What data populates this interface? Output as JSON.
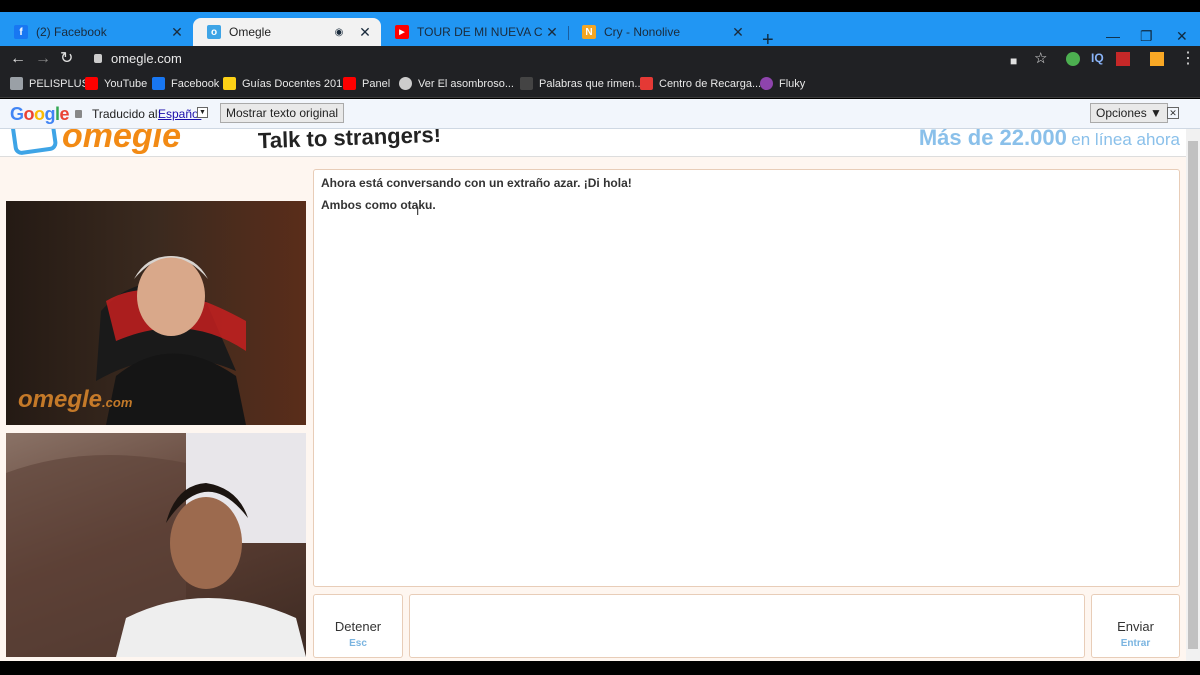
{
  "browser": {
    "tabs": [
      {
        "label": "(2) Facebook",
        "icon": "facebook-icon",
        "color": "#1877f2",
        "glyph": "f"
      },
      {
        "label": "Omegle",
        "icon": "omegle-icon",
        "color": "#3ea4e6",
        "glyph": "o"
      },
      {
        "label": "TOUR DE MI NUEVA CASA (de no",
        "icon": "youtube-icon",
        "color": "#ff0000",
        "glyph": "▶"
      },
      {
        "label": "Cry - Nonolive",
        "icon": "nonolive-icon",
        "color": "#f5a623",
        "glyph": "N"
      }
    ],
    "new_tab": "+",
    "url": "omegle.com",
    "ext_iq": "IQ",
    "bookmarks": [
      {
        "label": "PELISPLUS",
        "color": "#9aa0a6"
      },
      {
        "label": "YouTube",
        "color": "#ff0000"
      },
      {
        "label": "Facebook",
        "color": "#1877f2"
      },
      {
        "label": "Guías Docentes 201...",
        "color": "#fcd116"
      },
      {
        "label": "Panel",
        "color": "#ff0000"
      },
      {
        "label": "Ver El asombroso...",
        "color": "#cccccc"
      },
      {
        "label": "Palabras que rimen...",
        "color": "#444444"
      },
      {
        "label": "Centro de Recarga...",
        "color": "#e53935"
      },
      {
        "label": "Fluky",
        "color": "#8e44ad"
      }
    ]
  },
  "translate": {
    "translated_to": "Traducido al:",
    "language": "Español",
    "show_original": "Mostrar texto original",
    "options": "Opciones ▼"
  },
  "omegle": {
    "logo": "omegle",
    "tagline": "Talk to strangers!",
    "online_count": "Más de 22.000",
    "online_suffix": "en línea ahora",
    "watermark": "omegle",
    "watermark_suffix": ".com",
    "chat": [
      "Ahora está conversando con un extraño azar. ¡Di hola!",
      "Ambos como otaku."
    ],
    "stop_label": "Detener",
    "stop_key": "Esc",
    "send_label": "Enviar",
    "send_key": "Entrar",
    "message_value": ""
  }
}
